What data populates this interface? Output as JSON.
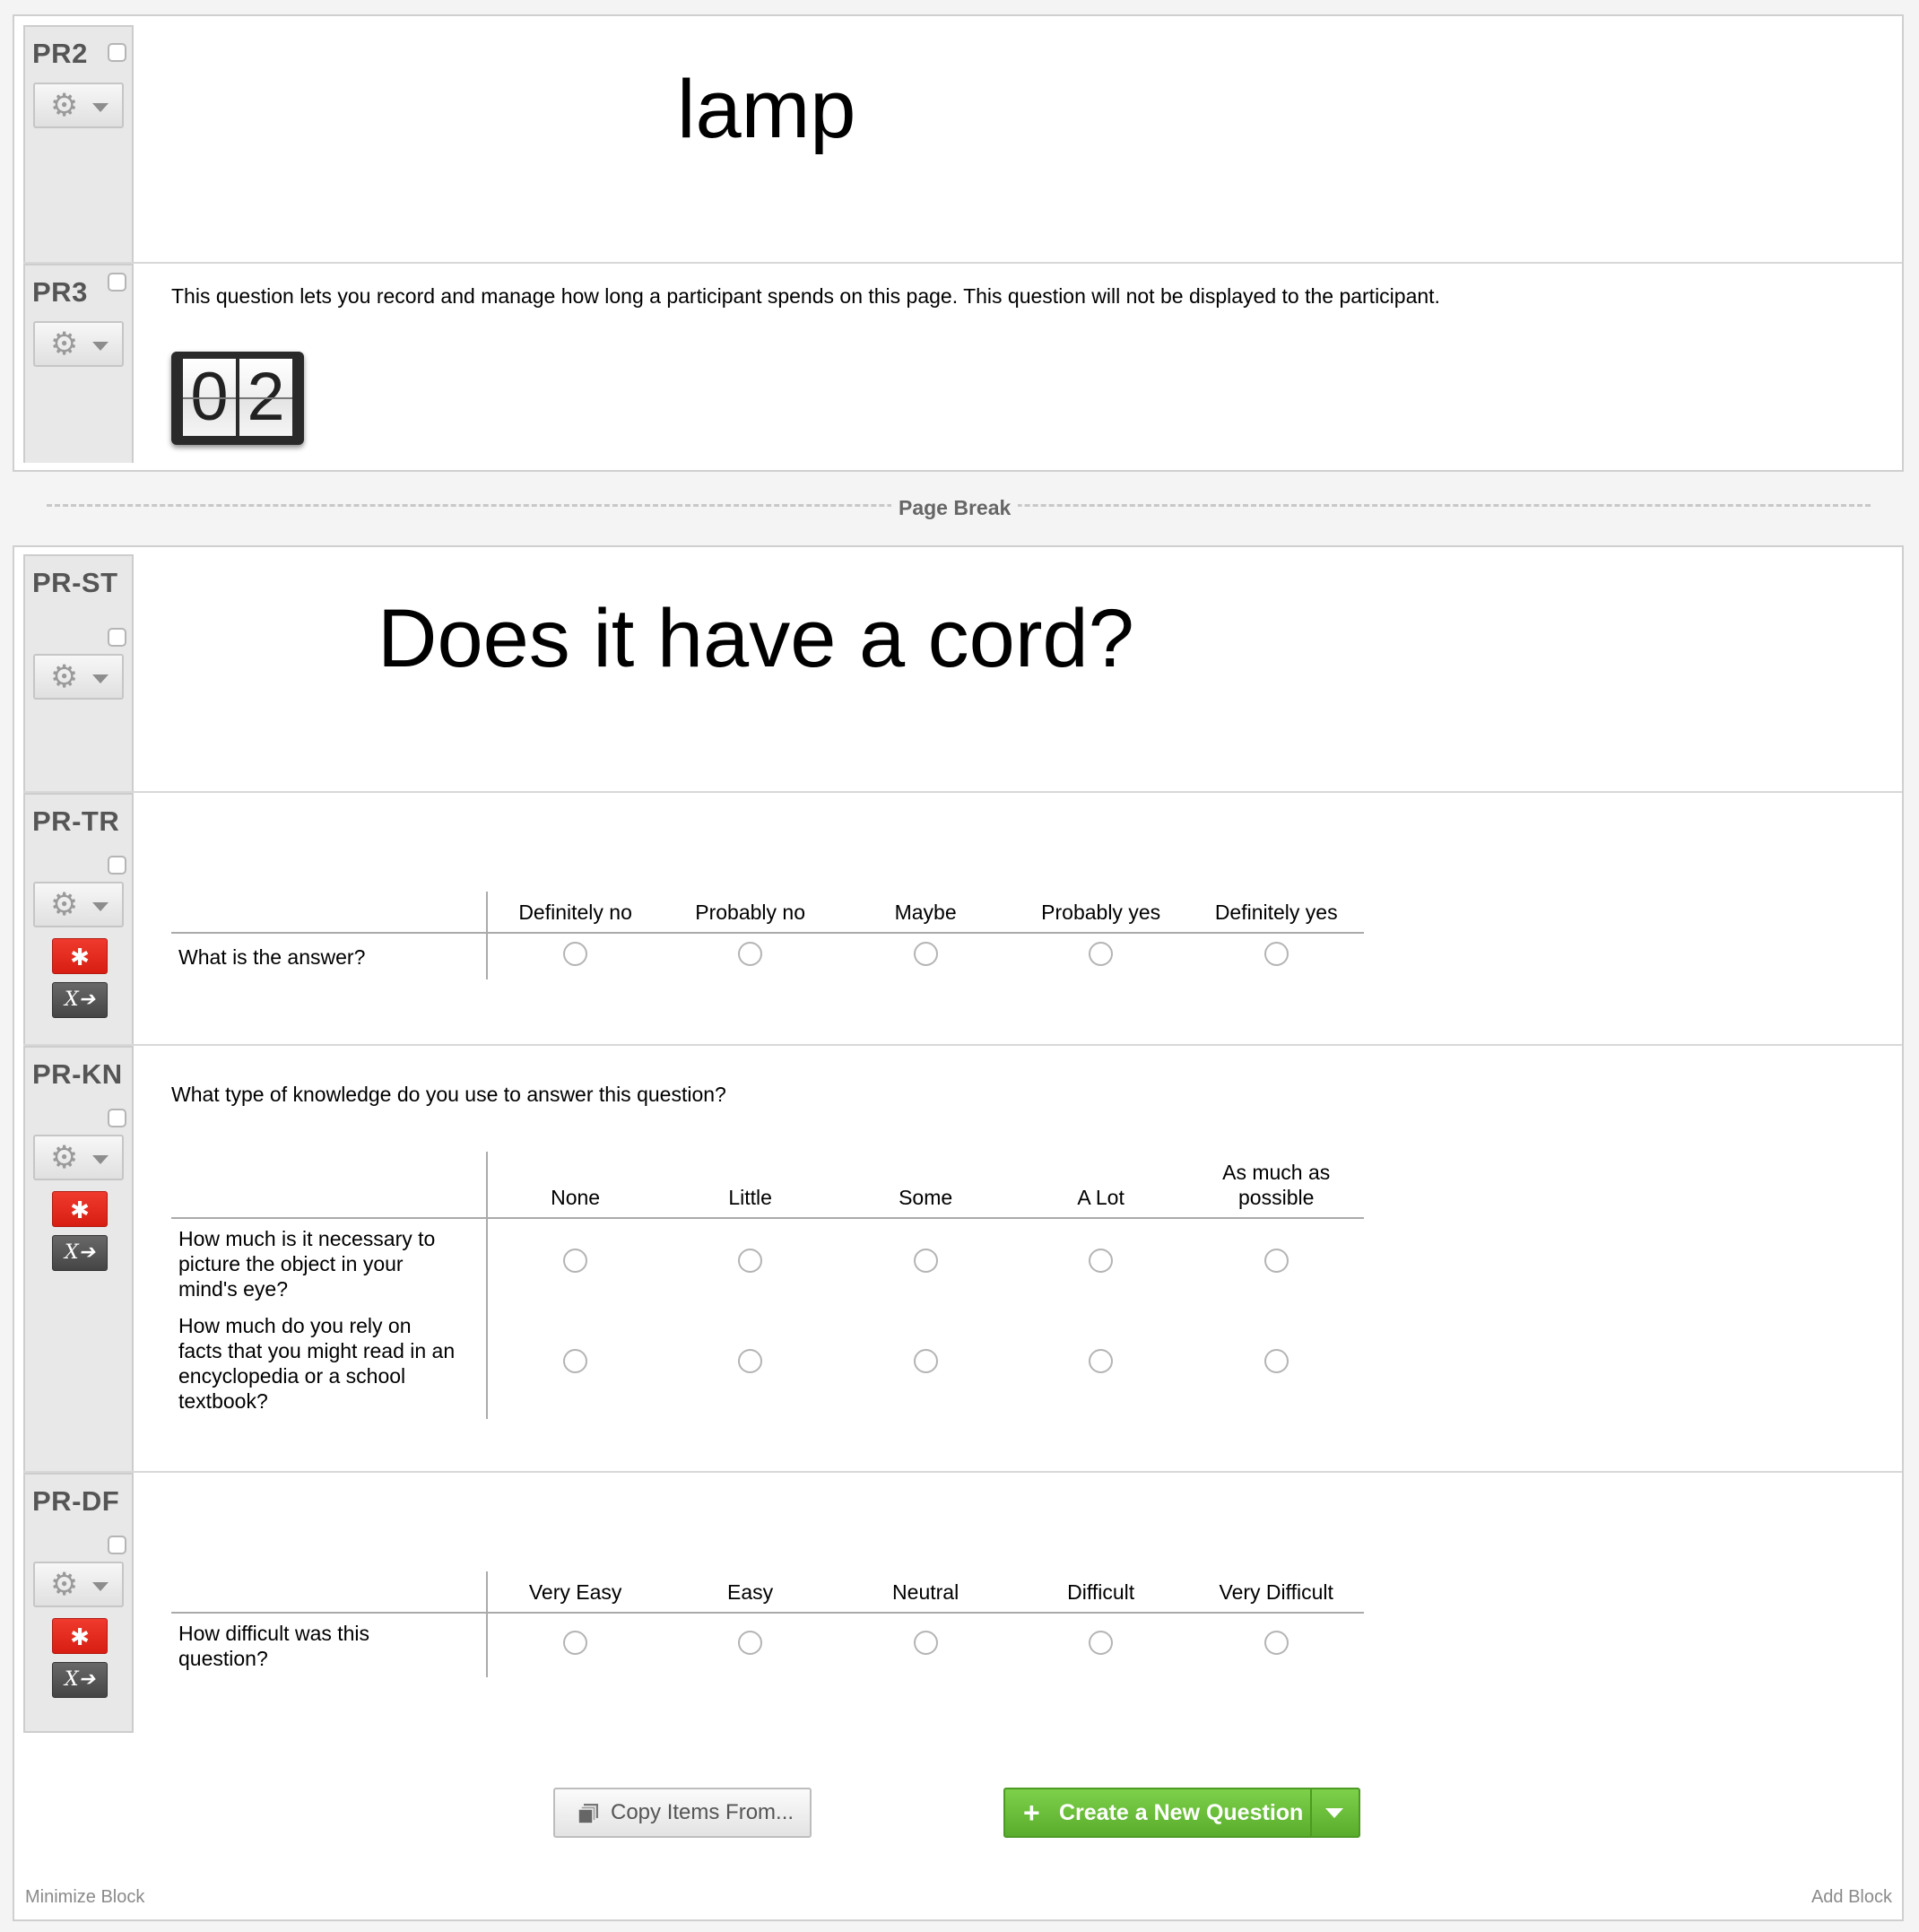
{
  "block_one": {
    "questions": [
      {
        "id": "PR2",
        "text": "lamp"
      },
      {
        "id": "PR3",
        "description": "This question lets you record and manage how long a participant spends on this page. This question will not be displayed to the participant.",
        "timer_digits": [
          "0",
          "2"
        ]
      }
    ]
  },
  "page_break": {
    "label": "Page Break"
  },
  "block_two": {
    "questions": [
      {
        "id": "PR-ST",
        "text": "Does it have a cord?"
      },
      {
        "id": "PR-TR",
        "required": true,
        "columns": [
          "Definitely no",
          "Probably no",
          "Maybe",
          "Probably yes",
          "Definitely yes"
        ],
        "rows": [
          "What is the answer?"
        ]
      },
      {
        "id": "PR-KN",
        "required": true,
        "prompt": "What type of knowledge do you use to answer this question?",
        "columns": [
          "None",
          "Little",
          "Some",
          "A Lot",
          "As much as possible"
        ],
        "rows": [
          "How much is it necessary to picture the object in your mind's eye?",
          "How much do you rely on facts that you might read in an encyclopedia or a school textbook?"
        ]
      },
      {
        "id": "PR-DF",
        "required": true,
        "columns": [
          "Very Easy",
          "Easy",
          "Neutral",
          "Difficult",
          "Very Difficult"
        ],
        "rows": [
          "How difficult was this question?"
        ]
      }
    ],
    "actions": {
      "copy_label": "Copy Items From...",
      "create_label": "Create a New Question"
    },
    "footer": {
      "minimize_label": "Minimize Block",
      "add_label": "Add Block"
    }
  },
  "icons": {
    "gear": "gear-icon",
    "required": "asterisk-icon",
    "variable": "x-arrow-icon",
    "copy": "copy-icon",
    "plus": "plus-icon",
    "caret": "caret-down-icon"
  },
  "colors": {
    "accent_green": "#6bbf3a",
    "required_red": "#e32b1f",
    "sidebar_gray": "#e8e8e8"
  }
}
